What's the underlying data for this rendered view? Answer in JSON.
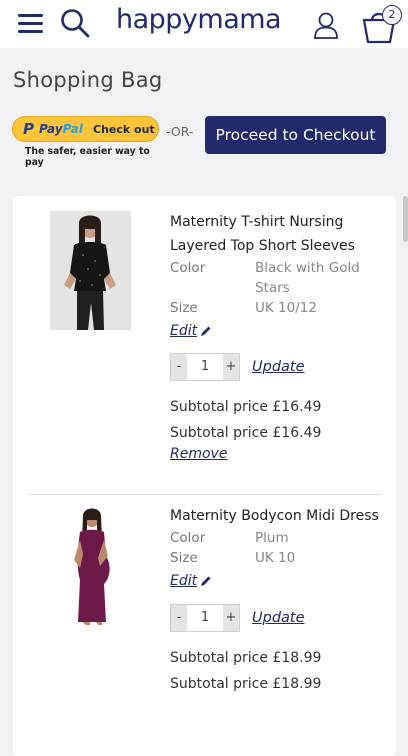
{
  "header": {
    "logo_text": "happymama",
    "bag_count": "2"
  },
  "page": {
    "title": "Shopping Bag"
  },
  "checkout": {
    "paypal_pay": "Pay",
    "paypal_pal": "Pal",
    "paypal_checkout": "Check out",
    "paypal_tagline": "The safer, easier way to pay",
    "or_text": "-OR-",
    "proceed_label": "Proceed to Checkout"
  },
  "items": [
    {
      "name": "Maternity T-shirt Nursing Layered Top Short Sleeves",
      "color_label": "Color",
      "color_value": "Black with Gold Stars",
      "size_label": "Size",
      "size_value": "UK 10/12",
      "edit_label": "Edit",
      "qty_minus": "-",
      "qty_value": "1",
      "qty_plus": "+",
      "update_label": "Update",
      "subtotal_1": "Subtotal price £16.49",
      "subtotal_2": "Subtotal price £16.49",
      "remove_label": "Remove"
    },
    {
      "name": "Maternity Bodycon Midi Dress",
      "color_label": "Color",
      "color_value": "Plum",
      "size_label": "Size",
      "size_value": "UK 10",
      "edit_label": "Edit",
      "qty_minus": "-",
      "qty_value": "1",
      "qty_plus": "+",
      "update_label": "Update",
      "subtotal_1": "Subtotal price £18.99",
      "subtotal_2": "Subtotal price £18.99"
    }
  ],
  "colors": {
    "brand_navy": "#232a6b",
    "paypal_yellow": "#ffc43a",
    "background": "#f2f2f4"
  },
  "icons": [
    "menu-icon",
    "search-icon",
    "account-icon",
    "shopping-bag-icon",
    "pencil-icon"
  ]
}
